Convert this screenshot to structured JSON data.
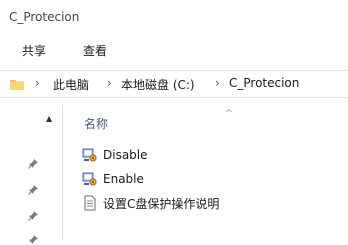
{
  "window": {
    "title": "C_Protecion"
  },
  "ribbon": {
    "tabs": [
      "共享",
      "查看"
    ]
  },
  "address": {
    "crumbs": [
      "此电脑",
      "本地磁盘 (C:)",
      "C_Protecion"
    ]
  },
  "file_list": {
    "column_name": "名称",
    "files": [
      {
        "name": "Disable",
        "icon": "batch-file-icon"
      },
      {
        "name": "Enable",
        "icon": "batch-file-icon"
      },
      {
        "name": "设置C盘保护操作说明",
        "icon": "text-file-icon"
      }
    ]
  },
  "colors": {
    "folder": "#f4c14f",
    "header_text": "#4c607a"
  }
}
